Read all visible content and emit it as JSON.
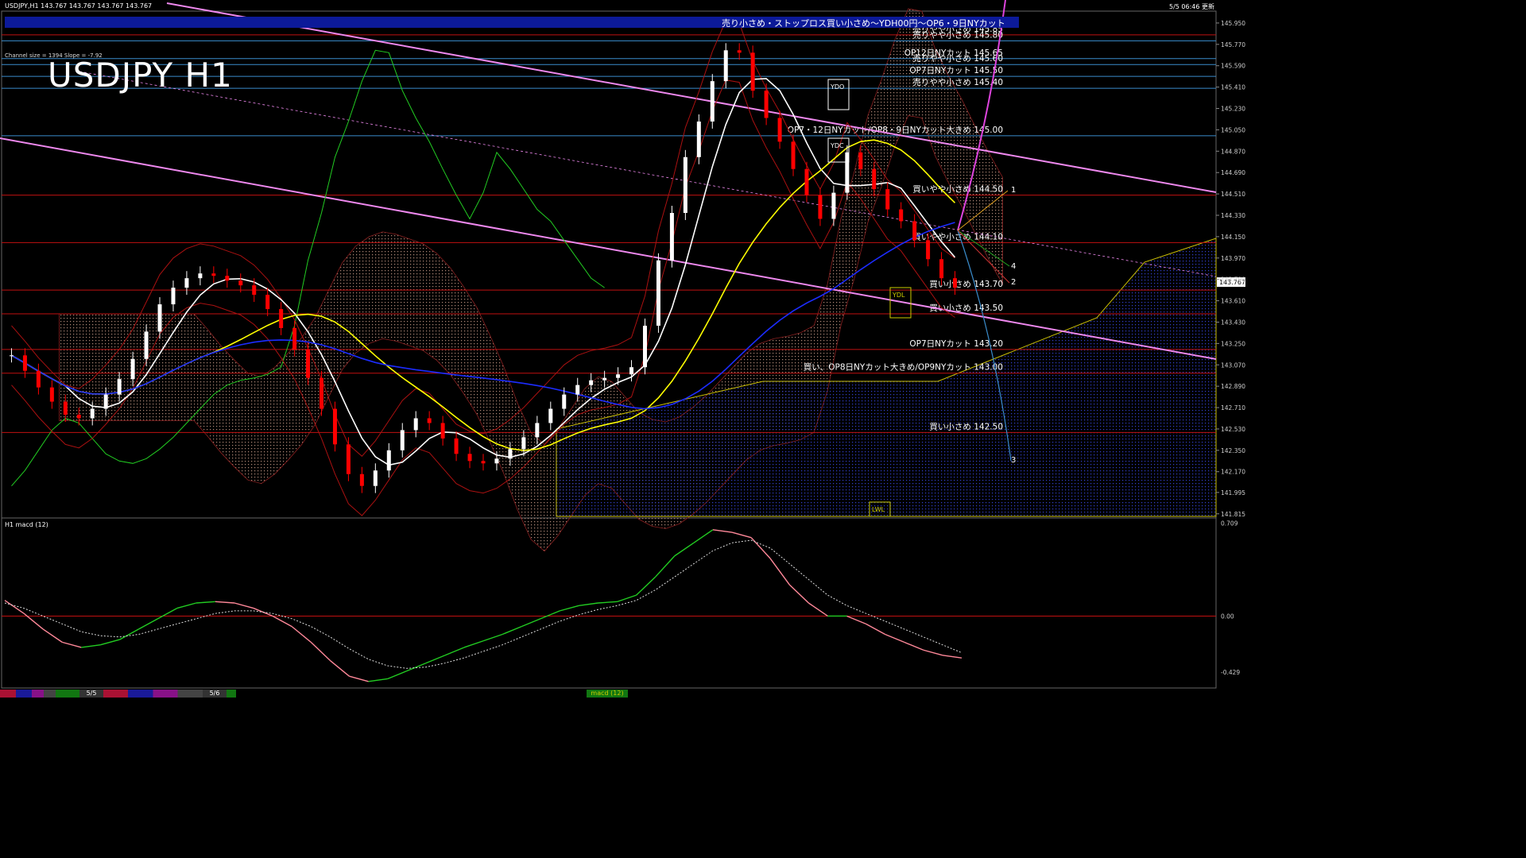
{
  "header": {
    "symbol_info": "USDJPY,H1  143.767 143.767 143.767 143.767",
    "update_time": "5/5 06:46 更新",
    "title": "USDJPY H1",
    "channel_info": "Channel size = 1394 Slope = -7.92",
    "banner": "売り小さめ・ストップロス買い小さめ～YDH00円～OP6・9日NYカット"
  },
  "price_axis": {
    "ticks": [
      "145.950",
      "145.770",
      "145.590",
      "145.410",
      "145.230",
      "145.050",
      "144.870",
      "144.690",
      "144.510",
      "144.330",
      "144.150",
      "143.970",
      "143.790",
      "143.610",
      "143.430",
      "143.250",
      "143.070",
      "142.890",
      "142.710",
      "142.530",
      "142.350",
      "142.170",
      "141.995",
      "141.815"
    ],
    "current_price": "143.767"
  },
  "macd_axis": {
    "label": "H1  macd (12)",
    "ticks": [
      "0.709",
      "0.00",
      "-0.429"
    ]
  },
  "colors": {
    "background": "#000000",
    "bull_candle": "#ffffff",
    "bear_candle": "#ff0000",
    "ma_white": "#ffffff",
    "ma_yellow": "#ffff00",
    "ma_blue": "#1c2cff",
    "chikou_green": "#22cc22",
    "channel_magenta": "#ee88ee",
    "level_red": "#c01010",
    "level_blue": "#3a8ccc",
    "banner": "#0c1a99"
  },
  "levels": [
    {
      "label": "売りやや小さめ 145.85",
      "price": 145.85,
      "color": "red"
    },
    {
      "label": "売りやや小さめ 145.80",
      "price": 145.8,
      "color": "blue"
    },
    {
      "label": "OP12日NYカット 145.65",
      "price": 145.65,
      "color": "blue"
    },
    {
      "label": "売りやや小さめ 145.60",
      "price": 145.6,
      "color": "blue"
    },
    {
      "label": "OP7日NYカット 145.50",
      "price": 145.5,
      "color": "blue"
    },
    {
      "label": "売りやや小さめ 145.40",
      "price": 145.4,
      "color": "blue"
    },
    {
      "label": "OP7・12日NYカット/OP8・9日NYカット大きめ 145.00",
      "price": 145.0,
      "color": "blue"
    },
    {
      "label": "買いやや小さめ 144.50",
      "price": 144.5,
      "color": "red"
    },
    {
      "label": "買いやや小さめ 144.10",
      "price": 144.1,
      "color": "red"
    },
    {
      "label": "買い小さめ 143.70",
      "price": 143.7,
      "color": "red"
    },
    {
      "label": "買い小さめ 143.50",
      "price": 143.5,
      "color": "red"
    },
    {
      "label": "OP7日NYカット 143.20",
      "price": 143.2,
      "color": "red"
    },
    {
      "label": "買い、OP8日NYカット大きめ/OP9NYカット 143.00",
      "price": 143.0,
      "color": "red"
    },
    {
      "label": "買い小さめ 142.50",
      "price": 142.5,
      "color": "red"
    }
  ],
  "markers": [
    {
      "label": "YDO"
    },
    {
      "label": "YDC"
    },
    {
      "label": "YDL"
    },
    {
      "label": "LWL"
    }
  ],
  "projection_labels": [
    "1",
    "4",
    "2",
    "3"
  ],
  "chart_data": {
    "type": "line",
    "title": "USDJPY H1",
    "ylim": [
      141.78,
      146.05
    ],
    "y2lim": [
      -0.55,
      0.75
    ],
    "series": [
      {
        "name": "price",
        "values": [
          143.15,
          143.02,
          142.88,
          142.76,
          142.65,
          142.62,
          142.7,
          142.82,
          142.95,
          143.12,
          143.35,
          143.58,
          143.72,
          143.8,
          143.84,
          143.82,
          143.78,
          143.74,
          143.66,
          143.54,
          143.38,
          143.2,
          142.96,
          142.7,
          142.4,
          142.15,
          142.05,
          142.18,
          142.35,
          142.52,
          142.62,
          142.58,
          142.45,
          142.32,
          142.26,
          142.24,
          142.28,
          142.36,
          142.46,
          142.58,
          142.7,
          142.82,
          142.9,
          142.94,
          142.96,
          142.99,
          143.05,
          143.4,
          143.95,
          144.35,
          144.82,
          145.12,
          145.46,
          145.72,
          145.7,
          145.38,
          145.15,
          144.95,
          144.72,
          144.5,
          144.3,
          144.52,
          144.86,
          144.72,
          144.55,
          144.38,
          144.28,
          144.12,
          143.96,
          143.8,
          143.72
        ]
      },
      {
        "name": "macd",
        "values": [
          0.12,
          0.02,
          -0.1,
          -0.2,
          -0.24,
          -0.22,
          -0.18,
          -0.1,
          -0.02,
          0.06,
          0.1,
          0.11,
          0.1,
          0.06,
          0.0,
          -0.08,
          -0.2,
          -0.34,
          -0.46,
          -0.5,
          -0.48,
          -0.42,
          -0.36,
          -0.3,
          -0.24,
          -0.19,
          -0.14,
          -0.08,
          -0.02,
          0.04,
          0.08,
          0.1,
          0.11,
          0.16,
          0.3,
          0.46,
          0.56,
          0.66,
          0.64,
          0.6,
          0.44,
          0.24,
          0.1,
          0.0,
          0.0,
          -0.06,
          -0.14,
          -0.2,
          -0.26,
          -0.3,
          -0.32
        ]
      },
      {
        "name": "signal",
        "values": [
          0.1,
          0.06,
          0.0,
          -0.06,
          -0.12,
          -0.15,
          -0.16,
          -0.14,
          -0.1,
          -0.06,
          -0.02,
          0.02,
          0.04,
          0.04,
          0.02,
          -0.02,
          -0.08,
          -0.16,
          -0.25,
          -0.33,
          -0.38,
          -0.4,
          -0.39,
          -0.36,
          -0.32,
          -0.27,
          -0.22,
          -0.16,
          -0.1,
          -0.04,
          0.01,
          0.05,
          0.08,
          0.12,
          0.2,
          0.3,
          0.4,
          0.5,
          0.56,
          0.58,
          0.52,
          0.4,
          0.28,
          0.16,
          0.08,
          0.02,
          -0.04,
          -0.1,
          -0.16,
          -0.22,
          -0.28
        ]
      }
    ]
  },
  "bottom_bar": {
    "tabs": [
      "5/5",
      "5/6"
    ],
    "indicator_tab": "macd (12)"
  }
}
